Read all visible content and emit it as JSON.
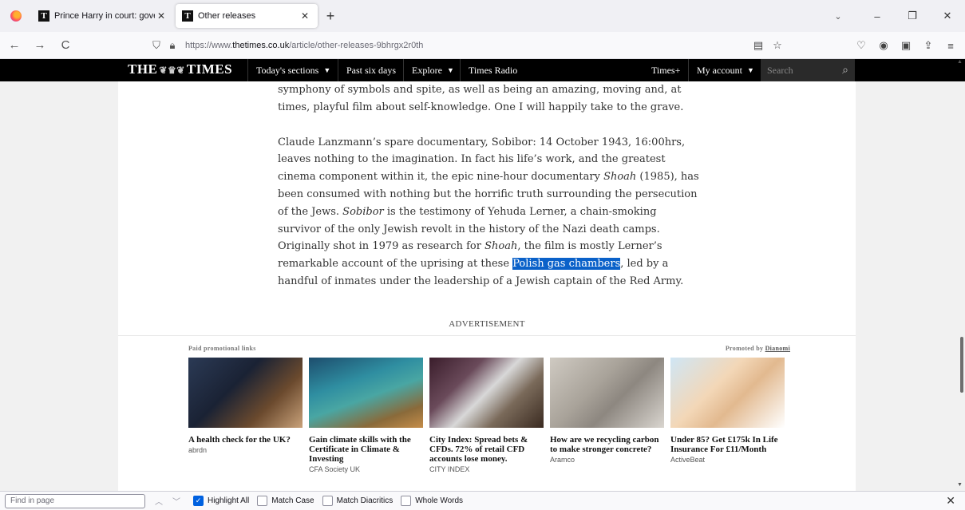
{
  "browser": {
    "tabs": [
      {
        "favicon": "T",
        "title": "Prince Harry in court: governme"
      },
      {
        "favicon": "T",
        "title": "Other releases"
      }
    ],
    "new_tab": "+",
    "list_all_tabs": "⌄",
    "window_controls": {
      "minimize": "–",
      "restore": "❐",
      "close": "✕"
    },
    "nav": {
      "back": "←",
      "forward": "→",
      "reload": "C"
    },
    "url_prefix": "https://www.",
    "url_domain": "thetimes.co.uk",
    "url_path": "/article/other-releases-9bhrgx2r0th",
    "icons": [
      "shield-icon",
      "lock-icon",
      "reader-view-icon",
      "bookmark-star-icon",
      "pocket-icon",
      "account-icon",
      "extensions-icon",
      "share-icon",
      "menu-icon"
    ]
  },
  "site": {
    "logo_left": "THE",
    "logo_crest": "❦♛❦",
    "logo_right": "TIMES",
    "nav": [
      {
        "label": "Today's sections",
        "chevron": true
      },
      {
        "label": "Past six days",
        "chevron": false
      },
      {
        "label": "Explore",
        "chevron": true
      },
      {
        "label": "Times Radio",
        "chevron": false
      }
    ],
    "times_plus": "Times+",
    "my_account": "My account",
    "search_placeholder": "Search"
  },
  "article": {
    "para1_l1": "symphony of symbols and spite, as well as being an amazing, moving and, at",
    "para1_l2": "times, playful film about self-knowledge. One I will happily take to the grave.",
    "p2_a": "Claude Lanzmann’s spare documentary, Sobibor: 14 October 1943, 16:00hrs, leaves nothing to the imagination. In fact his life’s work, and the greatest cinema component within it, the epic nine-hour documentary ",
    "p2_shoah1": "Shoah",
    "p2_b": " (1985), has been consumed with nothing but the horrific truth surrounding the persecution of the Jews. ",
    "p2_sobibor": "Sobibor",
    "p2_c": " is the testimony of Yehuda Lerner, a chain-smoking survivor of the only Jewish revolt in the history of the Nazi death camps. Originally shot in 1979 as research for ",
    "p2_shoah2": "Shoah",
    "p2_d": ", the film is mostly Lerner’s remarkable account of the uprising at these ",
    "p2_highlight": "Polish gas chambers",
    "p2_e": ", led by a handful of inmates under the leadership of a Jewish captain of the Red Army."
  },
  "ads": {
    "advertisement": "ADVERTISEMENT",
    "paid_label": "Paid promotional links",
    "promoted_by": "Promoted by",
    "promoter": "Dianomi",
    "cards": [
      {
        "title": "A health check for the UK?",
        "source": "abrdn"
      },
      {
        "title": "Gain climate skills with the Certificate in Climate & Investing",
        "source": "CFA Society UK"
      },
      {
        "title": "City Index: Spread bets & CFDs. 72% of retail CFD accounts lose money.",
        "source": "CITY INDEX"
      },
      {
        "title": "How are we recycling carbon to make stronger concrete?",
        "source": "Aramco"
      },
      {
        "title": "Under 85? Get £175k In Life Insurance For £11/Month",
        "source": "ActiveBeat"
      }
    ]
  },
  "findbar": {
    "placeholder": "Find in page",
    "highlight_all": "Highlight All",
    "highlight_all_checked": true,
    "match_case": "Match Case",
    "match_diacritics": "Match Diacritics",
    "whole_words": "Whole Words"
  }
}
